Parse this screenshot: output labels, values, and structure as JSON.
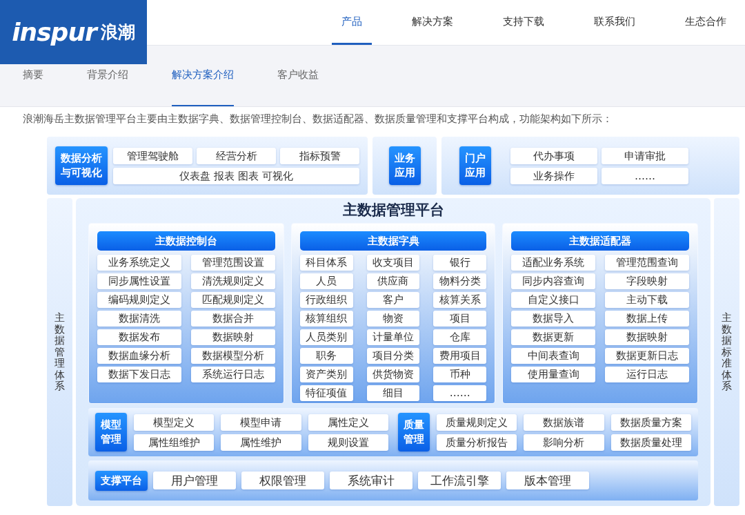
{
  "header": {
    "logo": {
      "latin": "inspur",
      "chinese": "浪潮"
    },
    "nav": [
      {
        "label": "产品",
        "selected": true
      },
      {
        "label": "解决方案",
        "selected": false
      },
      {
        "label": "支持下载",
        "selected": false
      },
      {
        "label": "联系我们",
        "selected": false
      },
      {
        "label": "生态合作",
        "selected": false
      }
    ]
  },
  "subnav": [
    {
      "label": "摘要",
      "selected": false
    },
    {
      "label": "背景介绍",
      "selected": false
    },
    {
      "label": "解决方案介绍",
      "selected": true
    },
    {
      "label": "客户收益",
      "selected": false
    }
  ],
  "intro": "浪潮海岳主数据管理平台主要由主数据字典、数据管理控制台、数据适配器、数据质量管理和支撑平台构成，功能架构如下所示：",
  "diagram": {
    "top_panels": [
      {
        "label": "数据分析与可视化",
        "chips": [
          "管理驾驶舱",
          "经营分析",
          "指标预警"
        ],
        "wide_chip": "仪表盘 报表 图表 可视化"
      },
      {
        "label": "业务应用"
      },
      {
        "label": "门户应用",
        "chips": [
          "代办事项",
          "申请审批",
          "业务操作",
          "……"
        ]
      }
    ],
    "side_left": "主数据管理体系",
    "side_right": "主数据标准体系",
    "platform_title": "主数据管理平台",
    "modules": [
      {
        "title": "主数据控制台",
        "kind": "pairs",
        "items": [
          "业务系统定义",
          "管理范围设置",
          "同步属性设置",
          "清洗规则定义",
          "编码规则定义",
          "匹配规则定义",
          "数据清洗",
          "数据合并",
          "数据发布",
          "数据映射",
          "数据血缘分析",
          "数据模型分析",
          "数据下发日志",
          "系统运行日志"
        ]
      },
      {
        "title": "主数据字典",
        "kind": "triples",
        "items": [
          "科目体系",
          "收支项目",
          "银行",
          "人员",
          "供应商",
          "物料分类",
          "行政组织",
          "客户",
          "核算关系",
          "核算组织",
          "物资",
          "项目",
          "人员类别",
          "计量单位",
          "仓库",
          "职务",
          "项目分类",
          "费用项目",
          "资产类别",
          "供货物资",
          "币种",
          "特征项值",
          "细目",
          "……"
        ]
      },
      {
        "title": "主数据适配器",
        "kind": "pairs",
        "items": [
          "适配业务系统",
          "管理范围查询",
          "同步内容查询",
          "字段映射",
          "自定义接口",
          "主动下载",
          "数据导入",
          "数据上传",
          "数据更新",
          "数据映射",
          "中间表查询",
          "数据更新日志",
          "使用量查询",
          "运行日志"
        ]
      }
    ],
    "quality_groups": [
      {
        "label": "模型管理",
        "items": [
          "模型定义",
          "模型申请",
          "属性定义",
          "属性组维护",
          "属性维护",
          "规则设置"
        ]
      },
      {
        "label": "质量管理",
        "items": [
          "质量规则定义",
          "数据族谱",
          "数据质量方案",
          "质量分析报告",
          "影响分析",
          "数据质量处理"
        ]
      }
    ],
    "support": {
      "label": "支撑平台",
      "items": [
        "用户管理",
        "权限管理",
        "系统审计",
        "工作流引擎",
        "版本管理"
      ]
    }
  }
}
